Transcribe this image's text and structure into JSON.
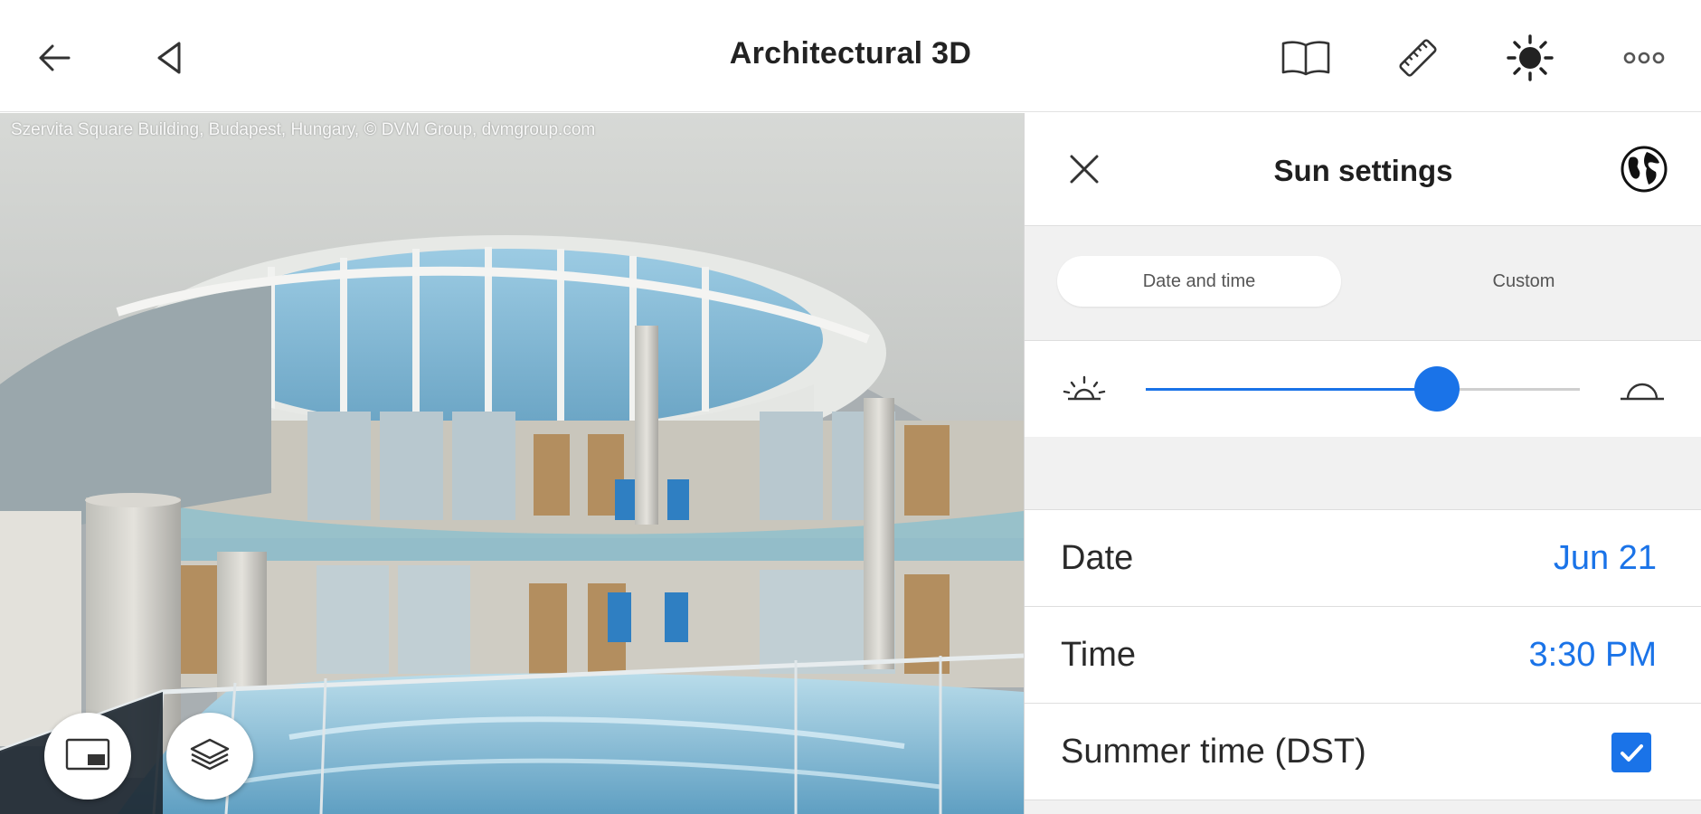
{
  "app": {
    "title": "Architectural 3D"
  },
  "topbar": {
    "icons": [
      "back-arrow-icon",
      "navigate-triangle-icon",
      "book-icon",
      "ruler-icon",
      "sun-icon",
      "more-icon"
    ]
  },
  "viewport": {
    "caption": "Szervita Square Building, Budapest, Hungary, © DVM Group, dvmgroup.com",
    "fabs": [
      "picture-in-picture-icon",
      "layers-icon"
    ]
  },
  "panel": {
    "title": "Sun settings",
    "tabs": [
      {
        "label": "Date and time",
        "active": true
      },
      {
        "label": "Custom",
        "active": false
      }
    ],
    "sun_position_fraction": 0.67,
    "rows": {
      "date": {
        "label": "Date",
        "value": "Jun 21"
      },
      "time": {
        "label": "Time",
        "value": "3:30 PM"
      },
      "dst": {
        "label": "Summer time (DST)",
        "checked": true
      }
    }
  },
  "colors": {
    "accent": "#1a73e8"
  }
}
